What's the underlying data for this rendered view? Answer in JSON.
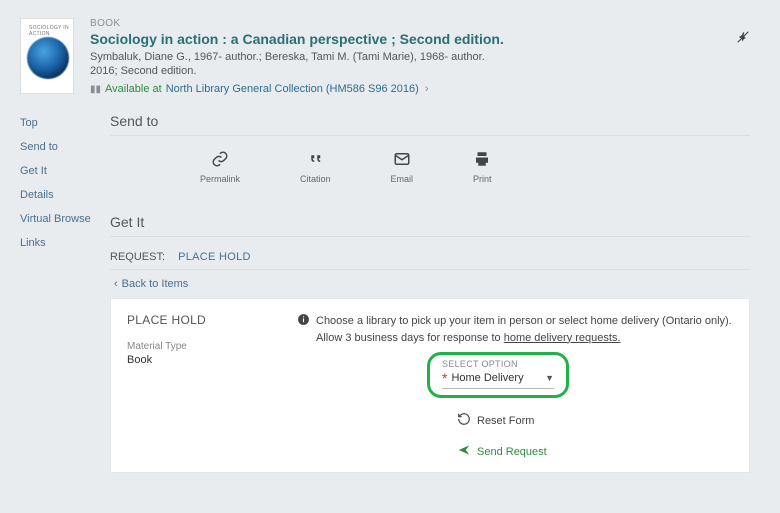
{
  "record": {
    "type_label": "BOOK",
    "title": "Sociology in action : a Canadian perspective ; Second edition.",
    "authors": "Symbaluk, Diane G., 1967- author.; Bereska, Tami M. (Tami Marie), 1968- author.",
    "edition_line": "2016; Second edition.",
    "availability_prefix": "Available at",
    "availability_location": "North Library  General Collection (HM586 S96 2016)",
    "cover_caption": "SOCIOLOGY IN ACTION"
  },
  "sidebar": {
    "items": [
      "Top",
      "Send to",
      "Get It",
      "Details",
      "Virtual Browse",
      "Links"
    ]
  },
  "send_to": {
    "heading": "Send to",
    "items": [
      {
        "label": "Permalink",
        "icon": "link-icon"
      },
      {
        "label": "Citation",
        "icon": "quote-icon"
      },
      {
        "label": "Email",
        "icon": "mail-icon"
      },
      {
        "label": "Print",
        "icon": "print-icon"
      }
    ]
  },
  "get_it": {
    "heading": "Get It",
    "request_label": "REQUEST:",
    "place_hold_label": "PLACE HOLD",
    "back_label": "Back to Items"
  },
  "hold_panel": {
    "title": "PLACE HOLD",
    "material_type_label": "Material Type",
    "material_type_value": "Book",
    "instruction_pre": "Choose a library to pick up your item in person or select home delivery (Ontario only). Allow 3 business days for response to ",
    "instruction_underlined": "home delivery requests.",
    "select_caption": "SELECT OPTION",
    "select_value": "Home Delivery",
    "reset_label": "Reset Form",
    "send_label": "Send Request"
  },
  "icons": {
    "pin_tooltip": "Pin"
  }
}
